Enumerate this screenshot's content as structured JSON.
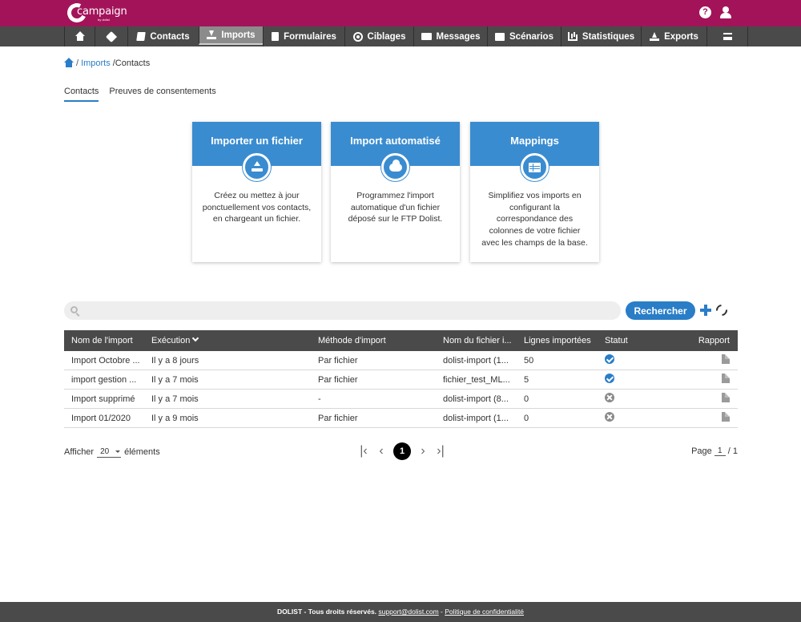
{
  "brand": {
    "logo_text": "campaign",
    "logo_sub": "by dolist",
    "colors": {
      "primary": "#a3135a",
      "accent": "#2a7dc7",
      "nav": "#4a4a4a"
    }
  },
  "nav": {
    "items": [
      {
        "label": "",
        "icon": "home-icon"
      },
      {
        "label": "",
        "icon": "tag-icon"
      },
      {
        "label": "Contacts",
        "icon": "book-icon"
      },
      {
        "label": "Imports",
        "icon": "download-icon",
        "active": true
      },
      {
        "label": "Formulaires",
        "icon": "document-icon"
      },
      {
        "label": "Ciblages",
        "icon": "target-icon"
      },
      {
        "label": "Messages",
        "icon": "envelope-icon"
      },
      {
        "label": "Scénarios",
        "icon": "film-icon"
      },
      {
        "label": "Statistiques",
        "icon": "bar-chart-icon"
      },
      {
        "label": "Exports",
        "icon": "upload-icon"
      },
      {
        "label": "",
        "icon": "menu-icon"
      }
    ]
  },
  "breadcrumb": {
    "imports": "Imports",
    "contacts": "/Contacts",
    "sep": "/"
  },
  "tabs": {
    "contacts": "Contacts",
    "consent": "Preuves de consentements"
  },
  "cards": [
    {
      "title": "Importer un fichier",
      "icon": "upload-icon",
      "text": "Créez ou mettez à jour ponctuellement vos contacts, en chargeant un fichier."
    },
    {
      "title": "Import automatisé",
      "icon": "cloud-icon",
      "text": "Programmez l'import automatique d'un fichier déposé sur le FTP Dolist."
    },
    {
      "title": "Mappings",
      "icon": "table-icon",
      "text": "Simplifiez vos imports en configurant la correspondance des colonnes de votre fichier avec les champs de la base."
    }
  ],
  "search": {
    "placeholder": "",
    "value": "",
    "button": "Rechercher"
  },
  "table": {
    "headers": {
      "name": "Nom de l'import",
      "exec": "Exécution",
      "method": "Méthode d'import",
      "file": "Nom du fichier i...",
      "lines": "Lignes importées",
      "status": "Statut",
      "report": "Rapport"
    },
    "rows": [
      {
        "name": "Import Octobre ...",
        "exec": "Il y a 8 jours",
        "method": "Par fichier",
        "file": "dolist-import (1...",
        "lines": "50",
        "status": "success"
      },
      {
        "name": "import gestion ...",
        "exec": "Il y a 7 mois",
        "method": "Par fichier",
        "file": "fichier_test_ML...",
        "lines": "5",
        "status": "success"
      },
      {
        "name": "Import supprimé",
        "exec": "Il y a 7 mois",
        "method": "-",
        "file": "dolist-import (8...",
        "lines": "0",
        "status": "deleted"
      },
      {
        "name": "Import 01/2020",
        "exec": "Il y a 9 mois",
        "method": "Par fichier",
        "file": "dolist-import (1...",
        "lines": "0",
        "status": "deleted"
      }
    ]
  },
  "pagination": {
    "show_label": "Afficher",
    "per_page": "20",
    "items_label": "éléments",
    "current_page": "1",
    "page_label": "Page",
    "page_value": "1",
    "total": "/ 1"
  },
  "footer": {
    "copyright": "DOLIST - Tous droits réservés.",
    "email": "support@dolist.com",
    "dash": "-",
    "privacy": "Politique de confidentialité"
  }
}
